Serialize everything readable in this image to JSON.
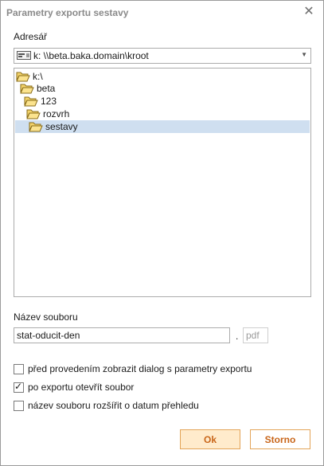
{
  "window": {
    "title": "Parametry exportu sestavy"
  },
  "directory": {
    "label": "Adresář",
    "selected_value": "k: \\\\beta.baka.domain\\kroot"
  },
  "tree": {
    "nodes": [
      {
        "label": "k:\\",
        "depth": 0,
        "selected": false
      },
      {
        "label": "beta",
        "depth": 1,
        "selected": false
      },
      {
        "label": "123",
        "depth": 2,
        "selected": false
      },
      {
        "label": "rozvrh",
        "depth": 3,
        "selected": false
      },
      {
        "label": "sestavy",
        "depth": 4,
        "selected": true
      }
    ]
  },
  "filename": {
    "label": "Název souboru",
    "value": "stat-oducit-den",
    "separator": ".",
    "extension": "pdf"
  },
  "options": [
    {
      "label": "před provedením zobrazit dialog s parametry exportu",
      "checked": false
    },
    {
      "label": "po exportu otevřít soubor",
      "checked": true
    },
    {
      "label": "název souboru rozšířit o datum přehledu",
      "checked": false
    }
  ],
  "buttons": {
    "ok": "Ok",
    "cancel": "Storno"
  },
  "colors": {
    "accent_text": "#c9661a",
    "ok_background": "#ffebcc",
    "button_border": "#e3a458",
    "selection": "#cfdff0"
  }
}
